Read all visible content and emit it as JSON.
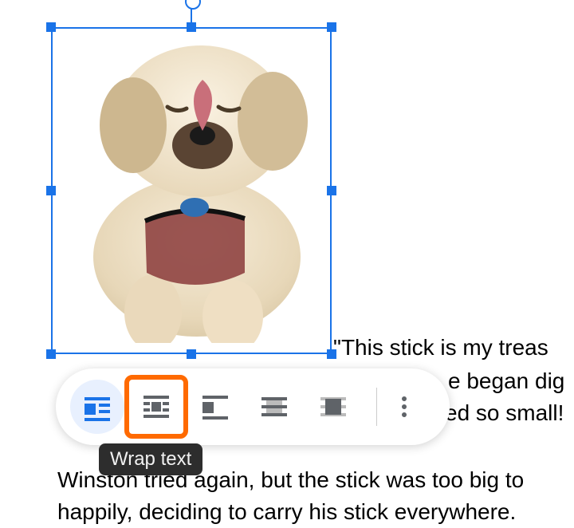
{
  "selection": {
    "object_type": "image",
    "alt": "dog-photo"
  },
  "document_text": {
    "line1_right": "\"This stick is my treas",
    "line2_right": "e began dig",
    "line3_right": "ed so small!",
    "line4": "Winston tried again, but the stick was too big to",
    "line5": "happily, deciding to carry his stick everywhere."
  },
  "toolbar": {
    "items": [
      {
        "name": "inline-with-text-icon",
        "active": true
      },
      {
        "name": "wrap-text-icon",
        "highlight": true
      },
      {
        "name": "break-text-icon"
      },
      {
        "name": "behind-text-icon"
      },
      {
        "name": "in-front-of-text-icon"
      }
    ],
    "more_label": "Image options"
  },
  "tooltip": {
    "text": "Wrap text"
  },
  "colors": {
    "selection_blue": "#1a73e8",
    "highlight_orange": "#ff6a00",
    "icon_gray": "#5f6368"
  }
}
